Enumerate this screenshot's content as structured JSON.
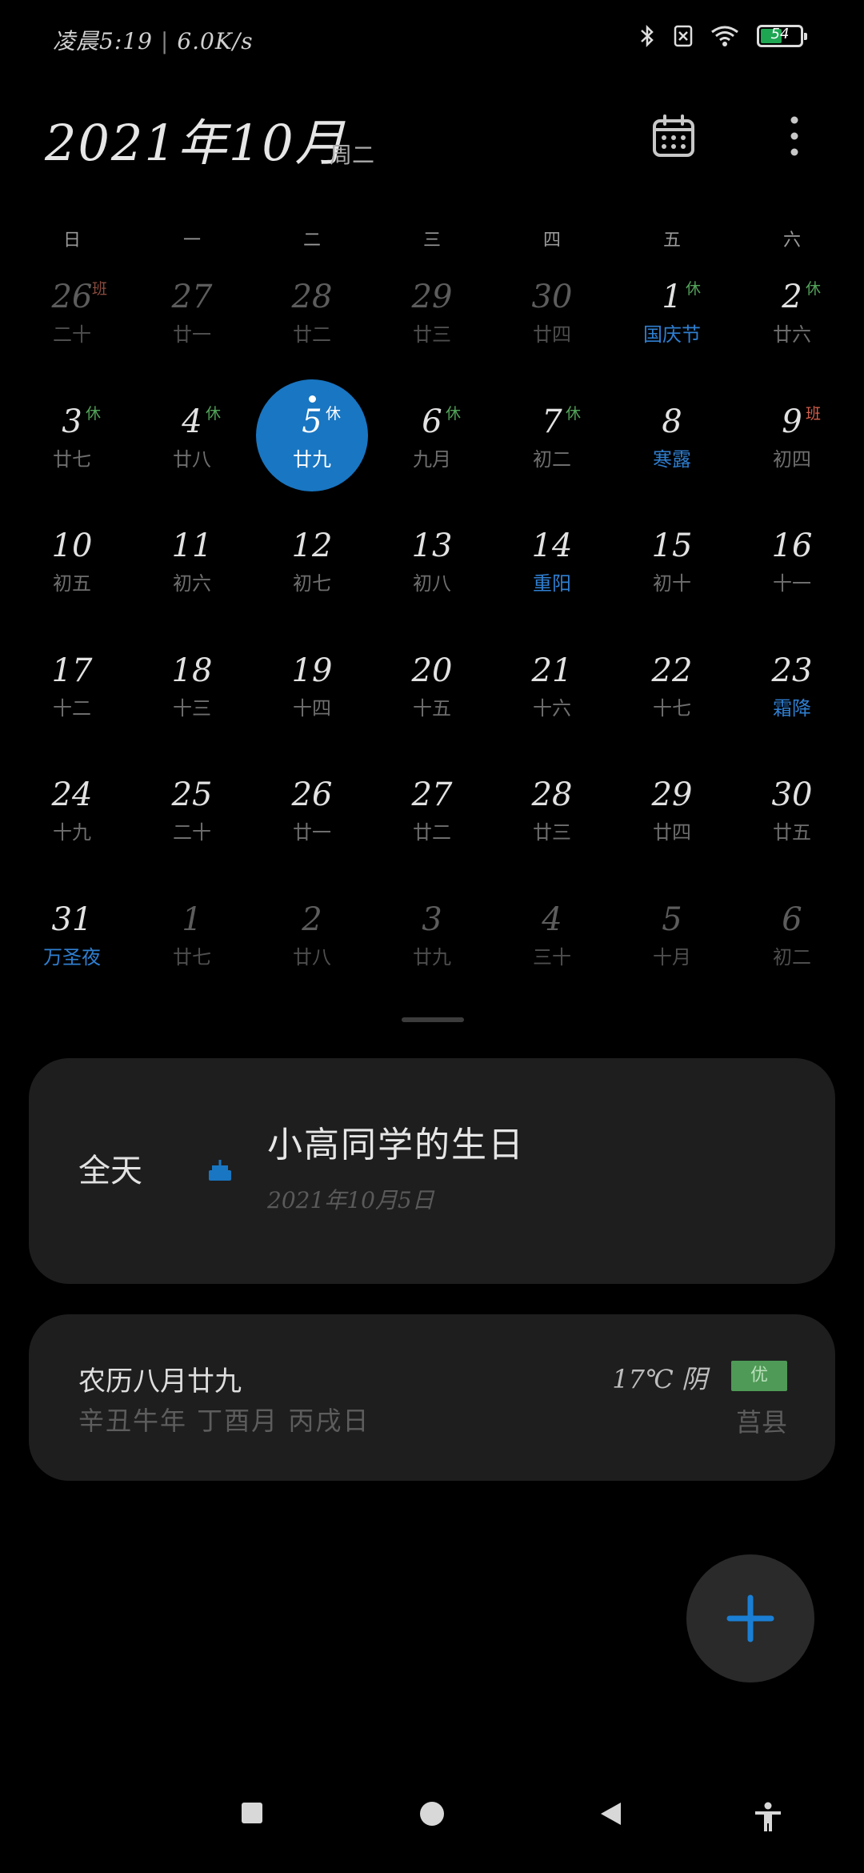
{
  "status_bar": {
    "time": "凌晨5:19",
    "net_speed": "6.0K/s",
    "battery_level": "54",
    "battery_fraction": 0.54,
    "icons": [
      "bluetooth-icon",
      "sim-disabled-icon",
      "wifi-icon",
      "battery-icon"
    ]
  },
  "header": {
    "title": "2021年10月",
    "weekday": "周二"
  },
  "weekdays": [
    "日",
    "一",
    "二",
    "三",
    "四",
    "五",
    "六"
  ],
  "calendar": {
    "cells": [
      {
        "day": "26",
        "sub": "二十",
        "badge": "班",
        "badge_type": "work",
        "other": true
      },
      {
        "day": "27",
        "sub": "廿一",
        "other": true
      },
      {
        "day": "28",
        "sub": "廿二",
        "other": true
      },
      {
        "day": "29",
        "sub": "廿三",
        "other": true
      },
      {
        "day": "30",
        "sub": "廿四",
        "other": true
      },
      {
        "day": "1",
        "sub": "国庆节",
        "sub_blue": true,
        "badge": "休"
      },
      {
        "day": "2",
        "sub": "廿六",
        "badge": "休"
      },
      {
        "day": "3",
        "sub": "廿七",
        "badge": "休"
      },
      {
        "day": "4",
        "sub": "廿八",
        "badge": "休"
      },
      {
        "day": "5",
        "sub": "廿九",
        "badge": "休",
        "selected": true
      },
      {
        "day": "6",
        "sub": "九月",
        "badge": "休"
      },
      {
        "day": "7",
        "sub": "初二",
        "badge": "休"
      },
      {
        "day": "8",
        "sub": "寒露",
        "sub_blue": true
      },
      {
        "day": "9",
        "sub": "初四",
        "badge": "班",
        "badge_type": "work"
      },
      {
        "day": "10",
        "sub": "初五"
      },
      {
        "day": "11",
        "sub": "初六"
      },
      {
        "day": "12",
        "sub": "初七"
      },
      {
        "day": "13",
        "sub": "初八"
      },
      {
        "day": "14",
        "sub": "重阳",
        "sub_blue": true
      },
      {
        "day": "15",
        "sub": "初十"
      },
      {
        "day": "16",
        "sub": "十一"
      },
      {
        "day": "17",
        "sub": "十二"
      },
      {
        "day": "18",
        "sub": "十三"
      },
      {
        "day": "19",
        "sub": "十四"
      },
      {
        "day": "20",
        "sub": "十五"
      },
      {
        "day": "21",
        "sub": "十六"
      },
      {
        "day": "22",
        "sub": "十七"
      },
      {
        "day": "23",
        "sub": "霜降",
        "sub_blue": true
      },
      {
        "day": "24",
        "sub": "十九"
      },
      {
        "day": "25",
        "sub": "二十"
      },
      {
        "day": "26",
        "sub": "廿一"
      },
      {
        "day": "27",
        "sub": "廿二"
      },
      {
        "day": "28",
        "sub": "廿三"
      },
      {
        "day": "29",
        "sub": "廿四"
      },
      {
        "day": "30",
        "sub": "廿五"
      },
      {
        "day": "31",
        "sub": "万圣夜",
        "sub_blue": true
      },
      {
        "day": "1",
        "sub": "廿七",
        "other": true
      },
      {
        "day": "2",
        "sub": "廿八",
        "other": true
      },
      {
        "day": "3",
        "sub": "廿九",
        "other": true
      },
      {
        "day": "4",
        "sub": "三十",
        "other": true
      },
      {
        "day": "5",
        "sub": "十月",
        "other": true
      },
      {
        "day": "6",
        "sub": "初二",
        "other": true
      }
    ]
  },
  "event": {
    "all_day": "全天",
    "icon": "cake-icon",
    "title": "小高同学的生日",
    "date": "2021年10月5日"
  },
  "lunar": {
    "title": "农历八月廿九",
    "ganzhi": "辛丑牛年  丁酉月  丙戌日",
    "weather": "17℃  阴",
    "aqi": "优",
    "city": "莒县"
  },
  "colors": {
    "accent": "#1976c2",
    "holiday_badge": "#52a35a",
    "work_badge": "#d35e4b",
    "festival_text": "#2f7fd1",
    "card_bg": "#1e1e1e"
  }
}
